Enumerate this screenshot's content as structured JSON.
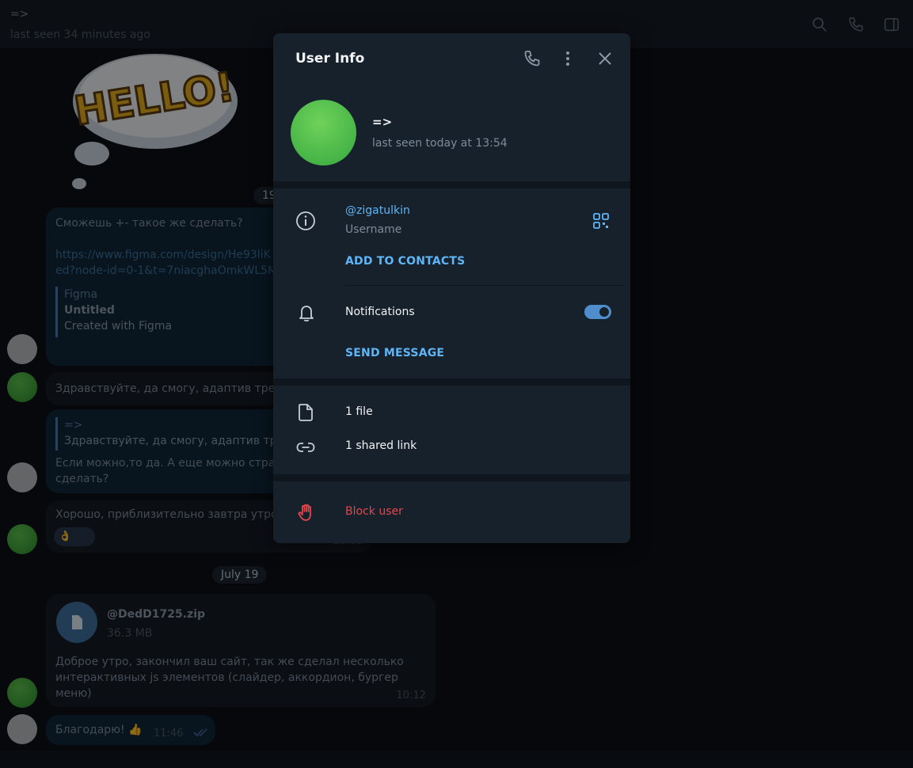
{
  "chat": {
    "title": "=>",
    "status": "last seen 34 minutes ago",
    "sticker_text": "HELLO!",
    "date_partial": "19",
    "messages": [
      {
        "text": "Сможешь +- такое же сделать?"
      },
      {
        "link_line1": "https://www.figma.com/design/He93liK",
        "link_line2": "ed?node-id=0-1&t=7niacghaOmkWL5M"
      },
      {
        "preview_site": "Figma",
        "preview_title": "Untitled",
        "preview_desc": "Created with Figma"
      },
      {
        "text": "Здравствуйте, да смогу, адаптив треб"
      },
      {
        "quote_author": "=>",
        "quote_text": "Здравствуйте, да смогу, адаптив тре",
        "text_line1": "Если можно,то да. А еще можно стран",
        "text_line2": "сделать?"
      },
      {
        "text": "Хорошо, приблизительно завтра утро",
        "reaction": "👌",
        "time": "20:03"
      }
    ],
    "date_pill": "July 19",
    "file": {
      "name": "@DedD1725.zip",
      "size": "36.3 MB"
    },
    "file_message": {
      "line1": "Доброе утро, закончил ваш сайт, так же сделал несколько",
      "line2": "интерактивных js элементов (слайдер, аккордион, бургер",
      "line3": "меню)",
      "time": "10:12"
    },
    "last_message": {
      "text": "Благодарю! 👍",
      "time": "11:46"
    }
  },
  "modal": {
    "title": "User Info",
    "name": "=>",
    "last_seen": "last seen today at 13:54",
    "username": "@zigatulkin",
    "username_label": "Username",
    "add_contacts": "ADD TO CONTACTS",
    "notifications_label": "Notifications",
    "notifications_on": true,
    "send_message": "SEND MESSAGE",
    "files": "1 file",
    "shared_links": "1 shared link",
    "block_user": "Block user"
  },
  "colors": {
    "accent": "#5eb5f7",
    "danger": "#e5464c",
    "panel": "#17212b",
    "toggle": "#4f8ecb"
  }
}
